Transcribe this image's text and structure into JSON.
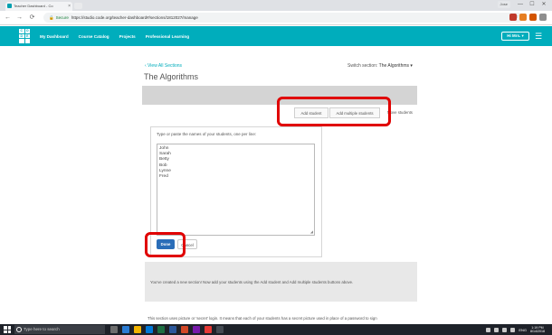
{
  "browser": {
    "tab_title": "Teacher Dashboard - Co",
    "tab_close": "×",
    "user_badge": "Jose",
    "window_min": "—",
    "window_max": "☐",
    "window_close": "✕",
    "back": "←",
    "forward": "→",
    "reload": "⟳",
    "secure_label": "Secure",
    "url": "https://studio.code.org/teacher-dashboard#/sections/1812027/manage",
    "star": "☆"
  },
  "site": {
    "logo_letters": [
      "C",
      "O",
      "D",
      "E",
      "",
      ""
    ],
    "nav": [
      "My Dashboard",
      "Course Catalog",
      "Projects",
      "Professional Learning"
    ],
    "user_button": "Hi Mrs. ▾",
    "menu": "☰"
  },
  "page": {
    "back_link": "‹  View All Sections",
    "switch_label": "Switch section:",
    "switch_value": "The Algorithms ▾",
    "title": "The Algorithms",
    "actions": {
      "add_student": "Add student",
      "add_multiple": "Add multiple students",
      "manage": "Move students"
    },
    "dialog": {
      "prompt": "Type or paste the names of your students, one per line:",
      "names": [
        "John",
        "Sarah",
        "Betty",
        "Bob",
        "Lynne",
        "Fred"
      ],
      "resize": "◢",
      "done": "Done",
      "cancel": "Cancel"
    },
    "info": "You've created a new section! Now add your students using the Add student and Add multiple students buttons above.",
    "bottom_text": "This section uses picture or 'secret' login. It means that each of your students has a secret picture used in place of a password to sign"
  },
  "taskbar": {
    "search_placeholder": "Type here to search",
    "language": "ENG",
    "time": "1:19 PM",
    "date": "8/14/2018"
  },
  "colors": {
    "brand_teal": "#00adbc",
    "done_blue": "#2a6db8",
    "annotation_red": "#e00000"
  }
}
